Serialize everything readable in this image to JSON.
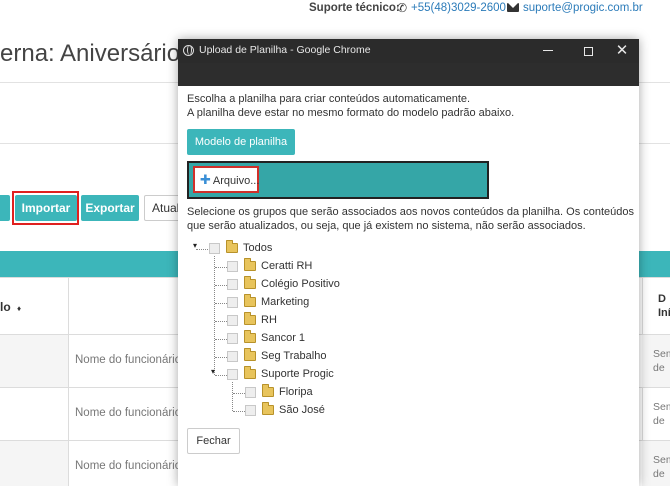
{
  "topbar": {
    "support_label": "Suporte técnico:",
    "phone": "+55(48)3029-2600",
    "email": "suporte@progic.com.br"
  },
  "page": {
    "title": "erna: Aniversários",
    "buttons": {
      "importar": "Importar",
      "exportar": "Exportar",
      "atualizar": "Atual"
    },
    "table": {
      "header_left": "lo",
      "header_left_sort": "♦",
      "header_right_1": "D",
      "header_right_2": "Iní",
      "cell_placeholder": "Nome do funcionário",
      "cell_right_1": "Sem",
      "cell_right_2": "de"
    }
  },
  "chrome": {
    "title": "Upload de Planilha - Google Chrome",
    "close_glyph": "✕"
  },
  "modal": {
    "intro_1": "Escolha a planilha para criar conteúdos automaticamente.",
    "intro_2": "A planilha deve estar no mesmo formato do modelo padrão abaixo.",
    "model_button": "Modelo de planilha",
    "file_button": "Arquivo...",
    "groups_text_1": "Selecione os grupos que serão associados aos novos conteúdos da planilha. Os conteúdos",
    "groups_text_2": "que serão atualizados, ou seja, que já existem no sistema, não serão associados.",
    "tree": {
      "root": "Todos",
      "items": [
        "Ceratti RH",
        "Colégio Positivo",
        "Marketing",
        "RH",
        "Sancor 1",
        "Seg Trabalho",
        "Suporte Progic"
      ],
      "sub_items": [
        "Floripa",
        "São José"
      ]
    },
    "close_button": "Fechar"
  },
  "colors": {
    "teal": "#3cb6ba",
    "teal_dark": "#35a6a7",
    "highlight_red": "#e0201f",
    "chrome_titlebar": "#2b2b2b"
  }
}
